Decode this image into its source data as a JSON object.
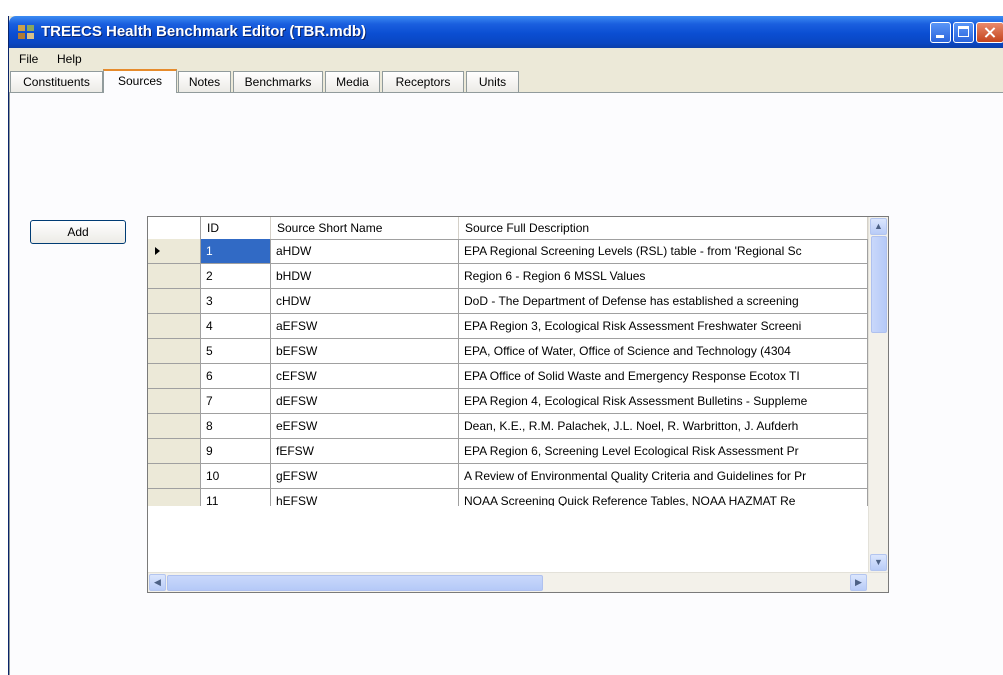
{
  "window": {
    "title": "TREECS Health Benchmark Editor (TBR.mdb)"
  },
  "menu": {
    "items": [
      "File",
      "Help"
    ]
  },
  "tabs": [
    {
      "label": "Constituents"
    },
    {
      "label": "Sources",
      "active": true
    },
    {
      "label": "Notes"
    },
    {
      "label": "Benchmarks"
    },
    {
      "label": "Media"
    },
    {
      "label": "Receptors"
    },
    {
      "label": "Units"
    }
  ],
  "toolbar": {
    "add_label": "Add"
  },
  "grid": {
    "columns": [
      "ID",
      "Source Short Name",
      "Source Full Description"
    ],
    "current_row_marker": "row-selector-arrow-icon",
    "rows": [
      {
        "id": "1",
        "short": "aHDW",
        "desc": "EPA Regional Screening Levels (RSL) table - from 'Regional Sc"
      },
      {
        "id": "2",
        "short": "bHDW",
        "desc": "Region 6 - Region 6 MSSL Values"
      },
      {
        "id": "3",
        "short": "cHDW",
        "desc": "DoD - The Department of Defense has established a screening"
      },
      {
        "id": "4",
        "short": "aEFSW",
        "desc": "EPA Region 3, Ecological Risk Assessment Freshwater Screeni"
      },
      {
        "id": "5",
        "short": "bEFSW",
        "desc": "EPA, Office of Water, Office of Science and Technology (4304"
      },
      {
        "id": "6",
        "short": "cEFSW",
        "desc": "EPA Office of Solid Waste and Emergency Response Ecotox TI"
      },
      {
        "id": "7",
        "short": "dEFSW",
        "desc": "EPA Region 4, Ecological Risk Assessment Bulletins - Suppleme"
      },
      {
        "id": "8",
        "short": "eEFSW",
        "desc": "Dean, K.E., R.M. Palachek, J.L. Noel, R. Warbritton, J. Aufderh"
      },
      {
        "id": "9",
        "short": "fEFSW",
        "desc": "EPA Region 6, Screening Level Ecological Risk Assessment Pr"
      },
      {
        "id": "10",
        "short": "gEFSW",
        "desc": "A Review of Environmental Quality Criteria and Guidelines for Pr"
      },
      {
        "id": "11",
        "short": "hEFSW",
        "desc": "NOAA Screening Quick Reference Tables, NOAA HAZMAT Re"
      }
    ]
  },
  "scrollbars": {
    "up_icon": "scroll-up-arrow-icon",
    "down_icon": "scroll-down-arrow-icon",
    "left_icon": "scroll-left-arrow-icon",
    "right_icon": "scroll-right-arrow-icon"
  }
}
